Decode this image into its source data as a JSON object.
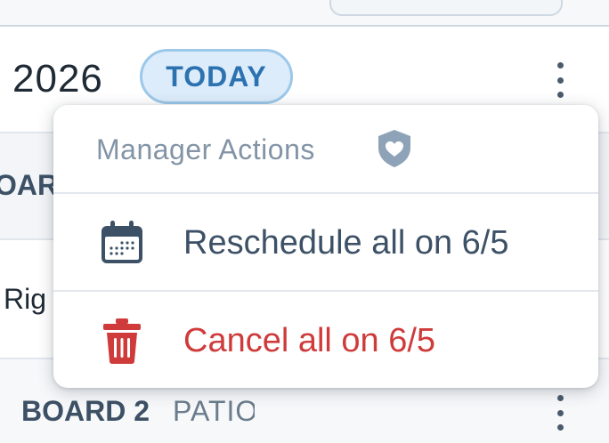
{
  "header": {
    "year": "2026",
    "today_badge": "TODAY"
  },
  "section": {
    "board_column_label": "OAR"
  },
  "row": {
    "text": "Rig"
  },
  "bottom_row": {
    "board": "BOARD 2",
    "location": "PATIO"
  },
  "menu": {
    "title": "Manager Actions",
    "title_icon": "shield-heart-icon",
    "items": [
      {
        "label": "Reschedule all on 6/5",
        "icon": "calendar-icon",
        "color": "#3d5166"
      },
      {
        "label": "Cancel all on 6/5",
        "icon": "trash-icon",
        "color": "#cf3b3b"
      }
    ]
  },
  "colors": {
    "accent": "#2c72b1",
    "danger": "#cf3b3b",
    "text": "#3d5166",
    "muted": "#8294a5"
  }
}
